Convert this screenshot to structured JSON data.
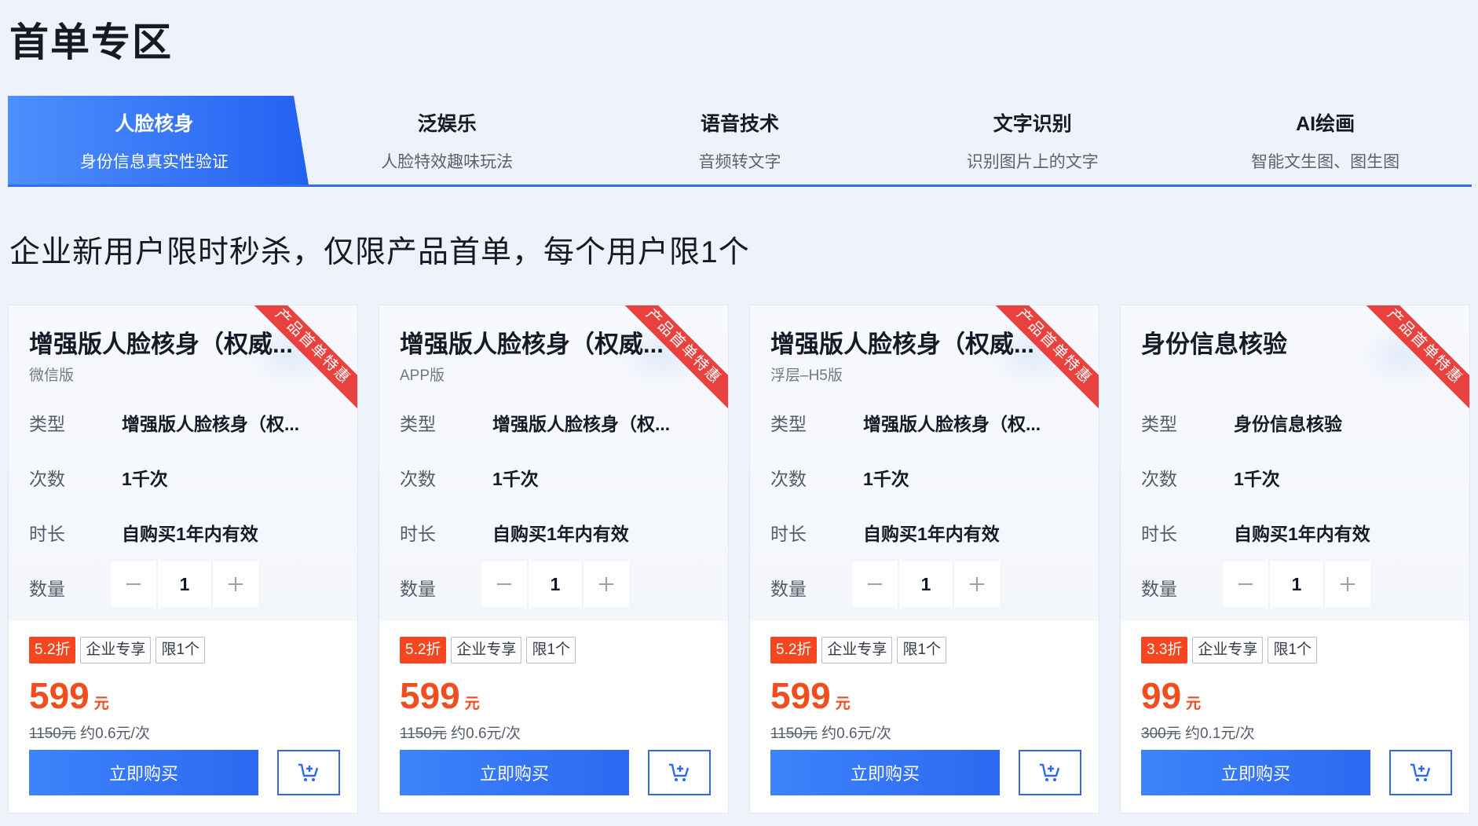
{
  "page": {
    "title": "首单专区"
  },
  "tabs": [
    {
      "title": "人脸核身",
      "subtitle": "身份信息真实性验证",
      "active": true
    },
    {
      "title": "泛娱乐",
      "subtitle": "人脸特效趣味玩法",
      "active": false
    },
    {
      "title": "语音技术",
      "subtitle": "音频转文字",
      "active": false
    },
    {
      "title": "文字识别",
      "subtitle": "识别图片上的文字",
      "active": false
    },
    {
      "title": "AI绘画",
      "subtitle": "智能文生图、图生图",
      "active": false
    }
  ],
  "promo_text": "企业新用户限时秒杀，仅限产品首单，每个用户限1个",
  "labels": {
    "type": "类型",
    "count": "次数",
    "duration": "时长",
    "quantity": "数量",
    "buy": "立即购买",
    "ribbon": "产品首单特惠",
    "tag_exclusive": "企业专享",
    "tag_limit": "限1个",
    "unit": "元"
  },
  "cards": [
    {
      "name": "增强版人脸核身（权威...",
      "variant": "微信版",
      "type": "增强版人脸核身（权...",
      "count": "1千次",
      "duration": "自购买1年内有效",
      "quantity": "1",
      "discount": "5.2折",
      "price": "599",
      "orig_price": "1150元",
      "per_use": "约0.6元/次"
    },
    {
      "name": "增强版人脸核身（权威...",
      "variant": "APP版",
      "type": "增强版人脸核身（权...",
      "count": "1千次",
      "duration": "自购买1年内有效",
      "quantity": "1",
      "discount": "5.2折",
      "price": "599",
      "orig_price": "1150元",
      "per_use": "约0.6元/次"
    },
    {
      "name": "增强版人脸核身（权威...",
      "variant": "浮层–H5版",
      "type": "增强版人脸核身（权...",
      "count": "1千次",
      "duration": "自购买1年内有效",
      "quantity": "1",
      "discount": "5.2折",
      "price": "599",
      "orig_price": "1150元",
      "per_use": "约0.6元/次"
    },
    {
      "name": "身份信息核验",
      "variant": "",
      "type": "身份信息核验",
      "count": "1千次",
      "duration": "自购买1年内有效",
      "quantity": "1",
      "discount": "3.3折",
      "price": "99",
      "orig_price": "300元",
      "per_use": "约0.1元/次"
    }
  ],
  "colors": {
    "accent": "#2f6ef6",
    "price": "#f14d1e",
    "ribbon": "#e9413e",
    "discount_tag": "#f5461f"
  },
  "icons": {
    "minus": "minus-icon",
    "plus": "plus-icon",
    "cart": "cart-icon"
  }
}
